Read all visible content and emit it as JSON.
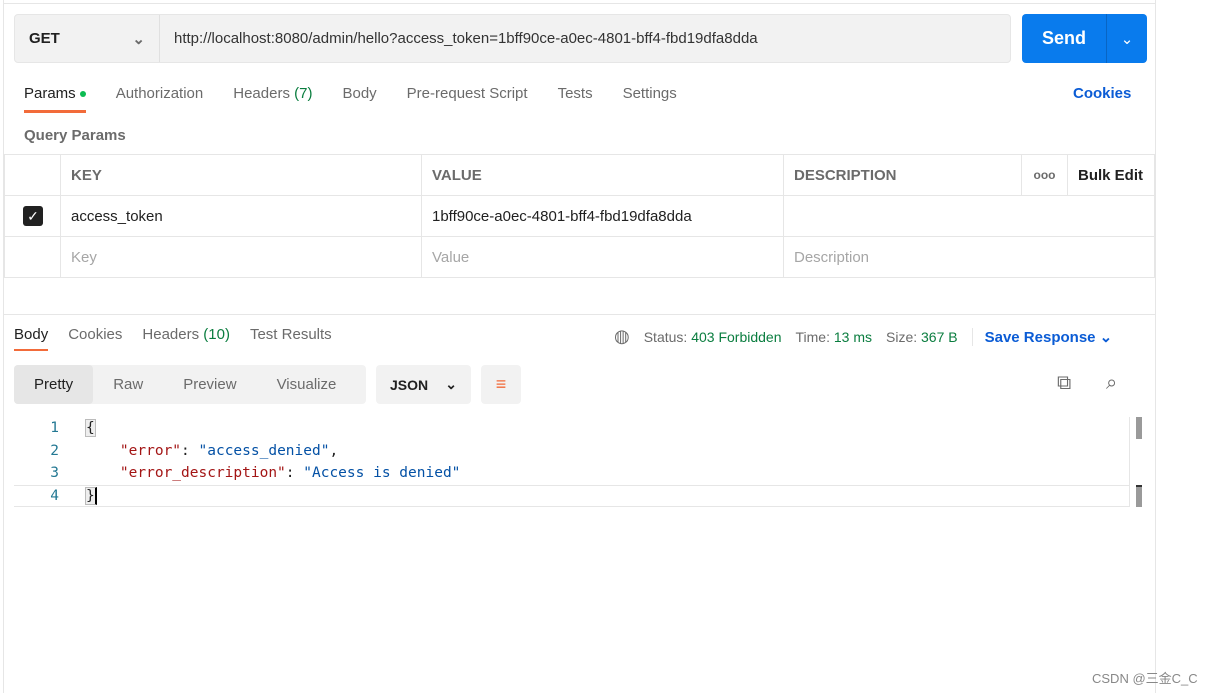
{
  "request": {
    "method": "GET",
    "url": "http://localhost:8080/admin/hello?access_token=1bff90ce-a0ec-4801-bff4-fbd19dfa8dda",
    "send_label": "Send"
  },
  "tabs": [
    {
      "label": "Params"
    },
    {
      "label": "Authorization"
    },
    {
      "label": "Headers",
      "count": "(7)"
    },
    {
      "label": "Body"
    },
    {
      "label": "Pre-request Script"
    },
    {
      "label": "Tests"
    },
    {
      "label": "Settings"
    }
  ],
  "cookies_label": "Cookies",
  "query_params_title": "Query Params",
  "params_table": {
    "headers": [
      "KEY",
      "VALUE",
      "DESCRIPTION"
    ],
    "more": "ooo",
    "bulk_edit": "Bulk Edit",
    "rows": [
      {
        "checked": true,
        "key": "access_token",
        "value": "1bff90ce-a0ec-4801-bff4-fbd19dfa8dda",
        "description": ""
      }
    ],
    "placeholders": {
      "key": "Key",
      "value": "Value",
      "description": "Description"
    }
  },
  "response": {
    "tabs": [
      {
        "label": "Body"
      },
      {
        "label": "Cookies"
      },
      {
        "label": "Headers",
        "count": "(10)"
      },
      {
        "label": "Test Results"
      }
    ],
    "status_label": "Status:",
    "status": "403 Forbidden",
    "time_label": "Time:",
    "time": "13 ms",
    "size_label": "Size:",
    "size": "367 B",
    "save_label": "Save Response",
    "views": [
      "Pretty",
      "Raw",
      "Preview",
      "Visualize"
    ],
    "format": "JSON",
    "lines": [
      {
        "n": "1",
        "t": "{"
      },
      {
        "n": "2",
        "k": "\"error\"",
        "v": "\"access_denied\"",
        "end": ","
      },
      {
        "n": "3",
        "k": "\"error_description\"",
        "v": "\"Access is denied\"",
        "end": ""
      },
      {
        "n": "4",
        "t": "}"
      }
    ]
  },
  "watermark": "CSDN @三金C_C",
  "colors": {
    "accent": "#f26b3a",
    "send": "#097bed",
    "status_ok": "#0a7d3f",
    "link": "#0b5cd5"
  }
}
